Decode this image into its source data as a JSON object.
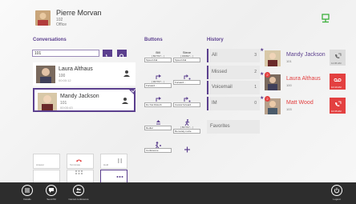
{
  "colors": {
    "accent": "#5b3f8e",
    "missed": "#e34040",
    "status": "#3cb03c"
  },
  "user": {
    "name": "Pierre Morvan",
    "ext": "102",
    "status": "Office"
  },
  "conversations": {
    "title": "Conversations",
    "search_value": "101",
    "items": [
      {
        "name": "Laura Althaus",
        "ext": "100",
        "time": "00:00:12"
      },
      {
        "name": "Mandy Jackson",
        "ext": "101",
        "time": "00:00:43"
      }
    ],
    "controls": [
      "Answer",
      "Terminate",
      "Hold",
      "",
      "",
      ""
    ]
  },
  "buttons": {
    "title": "Buttons",
    "cells": [
      {
        "top": "Bill",
        "mid": "[ 807707... ]",
        "btm": "Speed dial"
      },
      {
        "top": "Steve",
        "mid": "[ 336697... ]",
        "btm": "Speed dial"
      },
      {
        "top": "",
        "mid": "[ 907707... ]",
        "btm": "Forward..."
      },
      {
        "top": "",
        "mid": "",
        "btm": "Forward..."
      },
      {
        "top": "",
        "mid": "",
        "btm": "Do Not Disturb"
      },
      {
        "top": "",
        "mid": "",
        "btm": "Cancel forward"
      },
      {
        "top": "",
        "mid": "",
        "btm": "Redial"
      },
      {
        "top": "",
        "mid": "[ 807707... ]",
        "btm": "Remotely invite"
      },
      {
        "top": "",
        "mid": "",
        "btm": "Conference"
      },
      {
        "top": "",
        "mid": "",
        "btm": ""
      }
    ]
  },
  "history": {
    "title": "History",
    "filters": [
      {
        "label": "All",
        "count": "3"
      },
      {
        "label": "Missed",
        "count": "2"
      },
      {
        "label": "Voicemail",
        "count": "1"
      },
      {
        "label": "IM",
        "count": "0"
      }
    ],
    "favorites_label": "Favorites",
    "entries": [
      {
        "name": "Mandy Jackson",
        "ext": "101",
        "time": "11:05 AM",
        "missed": false,
        "badge": ""
      },
      {
        "name": "Laura Althaus",
        "ext": "100",
        "time": "10:40 AM",
        "missed": true,
        "badge": "2"
      },
      {
        "name": "Matt Wood",
        "ext": "103",
        "time": "10:35 AM",
        "missed": true,
        "badge": "2"
      }
    ]
  },
  "appbar": {
    "details": "Details",
    "send_im": "Send IM",
    "cancel_conference": "Cancel conference",
    "logout": "Logout"
  },
  "icons": [
    "user-photo",
    "network-icon",
    "phone-icon",
    "search-icon",
    "hold-icon",
    "forward-icon",
    "dnd-icon",
    "redial-icon",
    "walk-icon",
    "conference-icon",
    "plus-icon",
    "voicemail-icon",
    "logout-icon"
  ]
}
